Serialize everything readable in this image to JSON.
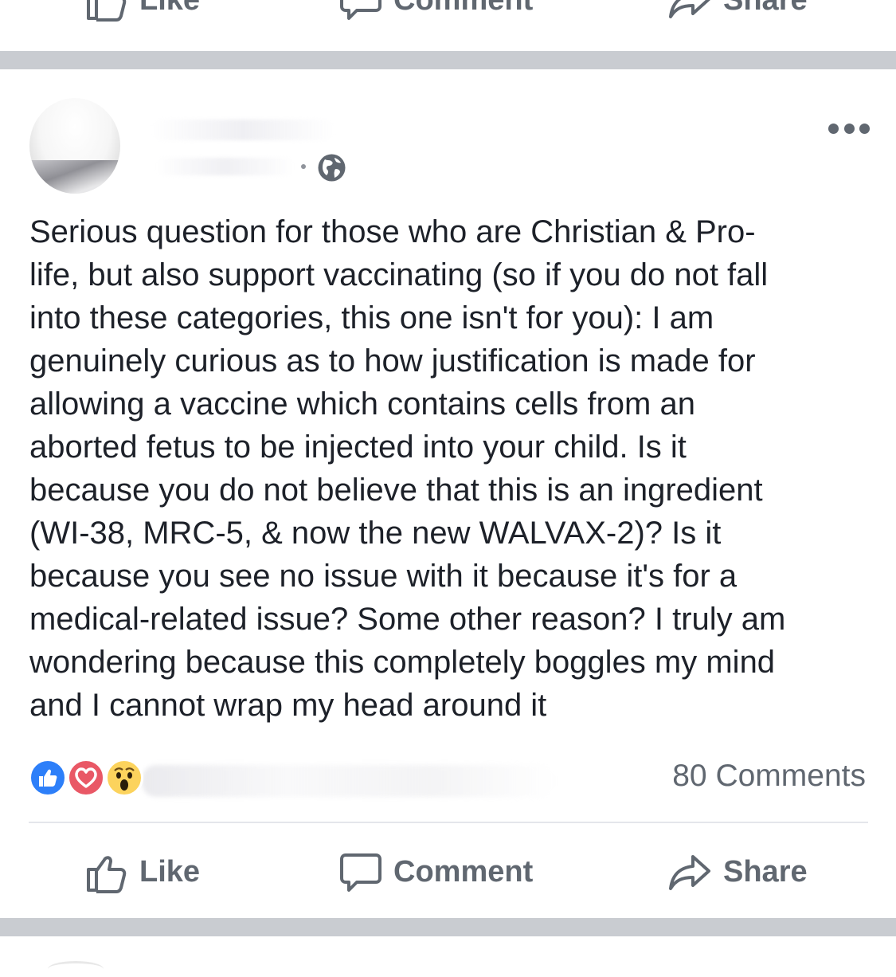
{
  "previous_post": {
    "actions": {
      "like_label": "Like",
      "comment_label": "Comment",
      "share_label": "Share"
    }
  },
  "post": {
    "author_name": "",
    "privacy_icon": "globe-icon",
    "menu_icon": "more-options-icon",
    "text_lines": [
      "Serious question for those who are Christian & Pro-",
      "life, but also support vaccinating (so if you do not fall",
      "into these categories, this one isn't for you): I am",
      "genuinely curious as to how justification is made for",
      "allowing a vaccine which contains cells from an",
      "aborted fetus to be injected into your child. Is it",
      "because you do not believe that this is an ingredient",
      "(WI-38, MRC-5, & now the new WALVAX-2)? Is it",
      "because you see no issue with it because it's for a",
      "medical-related issue? Some other reason? I truly am",
      "wondering because this completely boggles my mind",
      "and I cannot wrap my head around it"
    ],
    "reactions": {
      "icons": [
        "like-reaction-icon",
        "love-reaction-icon",
        "wow-reaction-icon"
      ],
      "comment_count_label": "80 Comments"
    },
    "actions": {
      "like_label": "Like",
      "comment_label": "Comment",
      "share_label": "Share"
    }
  },
  "colors": {
    "action_gray": "#606770",
    "separator": "#c9ccd1",
    "like_blue": "#2d7ff9",
    "love_red": "#e95866",
    "wow_yellow": "#fcd35d"
  }
}
